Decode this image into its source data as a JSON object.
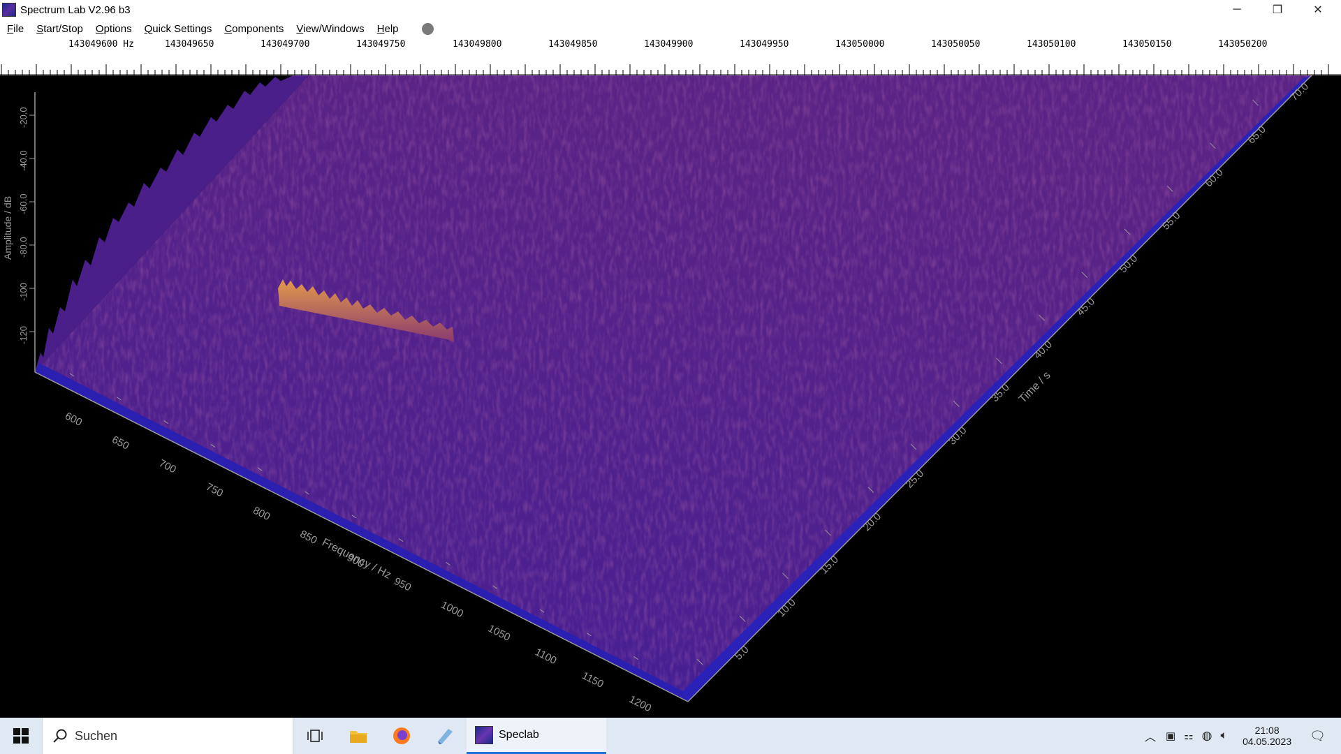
{
  "window": {
    "title": "Spectrum Lab V2.96 b3",
    "controls": {
      "minimize": "─",
      "restore": "❐",
      "close": "✕"
    }
  },
  "menu": [
    "File",
    "Start/Stop",
    "Options",
    "Quick Settings",
    "Components",
    "View/Windows",
    "Help"
  ],
  "ruler": {
    "labels": [
      "143049600 Hz",
      "143049650",
      "143049700",
      "143049750",
      "143049800",
      "143049850",
      "143049900",
      "143049950",
      "143050000",
      "143050050",
      "143050100",
      "143050150",
      "143050200"
    ]
  },
  "plot": {
    "amplitude_axis_label": "Amplitude / dB",
    "amplitude_ticks": [
      "-20.0",
      "-40.0",
      "-60.0",
      "-80.0",
      "-100",
      "-120"
    ],
    "frequency_axis_label": "Frequency / Hz",
    "frequency_ticks": [
      "600",
      "650",
      "700",
      "750",
      "800",
      "850",
      "900",
      "950",
      "1000",
      "1050",
      "1100",
      "1150",
      "1200"
    ],
    "time_axis_label": "Time / s",
    "time_ticks": [
      "5.0",
      "10.0",
      "15.0",
      "20.0",
      "25.0",
      "30.0",
      "35.0",
      "40.0",
      "45.0",
      "50.0",
      "55.0",
      "60.0",
      "65.0",
      "70.0"
    ],
    "colors": {
      "surface": "#4a1f8a",
      "peak": "#d4813a",
      "base": "#2a1e9a"
    }
  },
  "taskbar": {
    "search_placeholder": "Suchen",
    "app_label": "Speclab",
    "time": "21:08",
    "date": "04.05.2023"
  }
}
